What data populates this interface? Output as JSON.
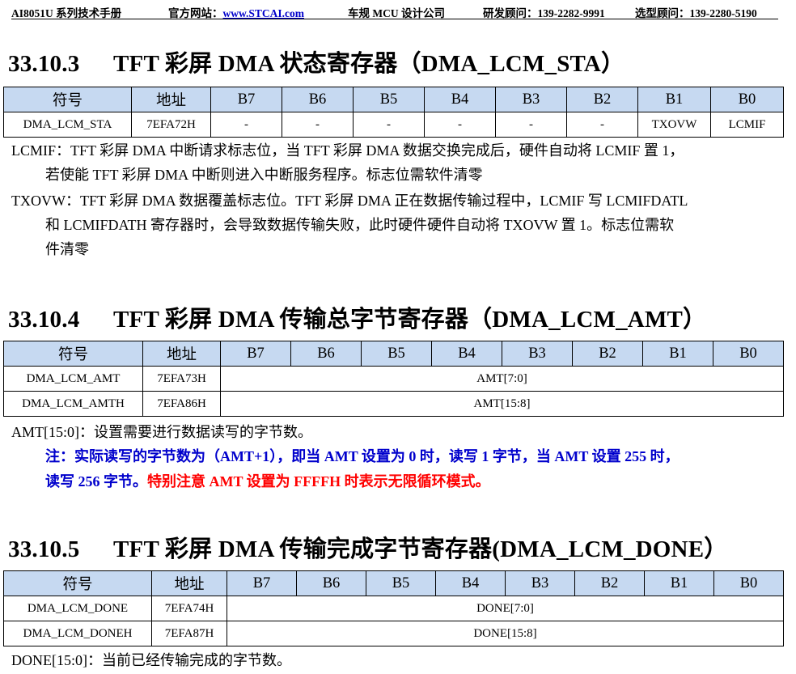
{
  "header": {
    "product": "AI8051U 系列技术手册",
    "website_label": "官方网站：",
    "website_url": "www.STCAI.com",
    "company": "车规 MCU 设计公司",
    "dev_contact": "研发顾问：139-2282-9991",
    "sel_contact": "选型顾问：139-2280-5190"
  },
  "sections": [
    {
      "number": "33.10.3",
      "title": "TFT 彩屏 DMA 状态寄存器（DMA_LCM_STA）",
      "table": {
        "headers": [
          "符号",
          "地址",
          "B7",
          "B6",
          "B5",
          "B4",
          "B3",
          "B2",
          "B1",
          "B0"
        ],
        "rows": [
          [
            "DMA_LCM_STA",
            "7EFA72H",
            "-",
            "-",
            "-",
            "-",
            "-",
            "-",
            "TXOVW",
            "LCMIF"
          ]
        ]
      },
      "desc": [
        "LCMIF：TFT 彩屏 DMA 中断请求标志位，当 TFT 彩屏 DMA 数据交换完成后，硬件自动将 LCMIF 置 1，",
        "若使能 TFT 彩屏 DMA 中断则进入中断服务程序。标志位需软件清零",
        "TXOVW：TFT 彩屏 DMA 数据覆盖标志位。TFT 彩屏 DMA 正在数据传输过程中，LCMIF 写 LCMIFDATL",
        "和 LCMIFDATH 寄存器时，会导致数据传输失败，此时硬件硬件自动将 TXOVW 置 1。标志位需软",
        "件清零"
      ]
    },
    {
      "number": "33.10.4",
      "title": "TFT 彩屏 DMA 传输总字节寄存器（DMA_LCM_AMT）",
      "table": {
        "headers": [
          "符号",
          "地址",
          "B7",
          "B6",
          "B5",
          "B4",
          "B3",
          "B2",
          "B1",
          "B0"
        ],
        "rows": [
          [
            "DMA_LCM_AMT",
            "7EFA73H",
            "AMT[7:0]"
          ],
          [
            "DMA_LCM_AMTH",
            "7EFA86H",
            "AMT[15:8]"
          ]
        ]
      },
      "desc": [
        "AMT[15:0]：设置需要进行数据读写的字节数。"
      ],
      "note_line1": "注：实际读写的字节数为（AMT+1），即当 AMT 设置为 0 时，读写 1 字节，当 AMT 设置 255 时，",
      "note_line2_blue": "读写 256 字节。",
      "note_line2_red": "特别注意 AMT 设置为 FFFFH 时表示无限循环模式。"
    },
    {
      "number": "33.10.5",
      "title": "TFT 彩屏 DMA 传输完成字节寄存器(DMA_LCM_DONE）",
      "table": {
        "headers": [
          "符号",
          "地址",
          "B7",
          "B6",
          "B5",
          "B4",
          "B3",
          "B2",
          "B1",
          "B0"
        ],
        "rows": [
          [
            "DMA_LCM_DONE",
            "7EFA74H",
            "DONE[7:0]"
          ],
          [
            "DMA_LCM_DONEH",
            "7EFA87H",
            "DONE[15:8]"
          ]
        ]
      },
      "desc": [
        "DONE[15:0]：当前已经传输完成的字节数。"
      ]
    }
  ],
  "colors": {
    "table_header_bg": "#c6d9f1",
    "note_blue": "#0000cc",
    "note_red": "#ff0000"
  }
}
